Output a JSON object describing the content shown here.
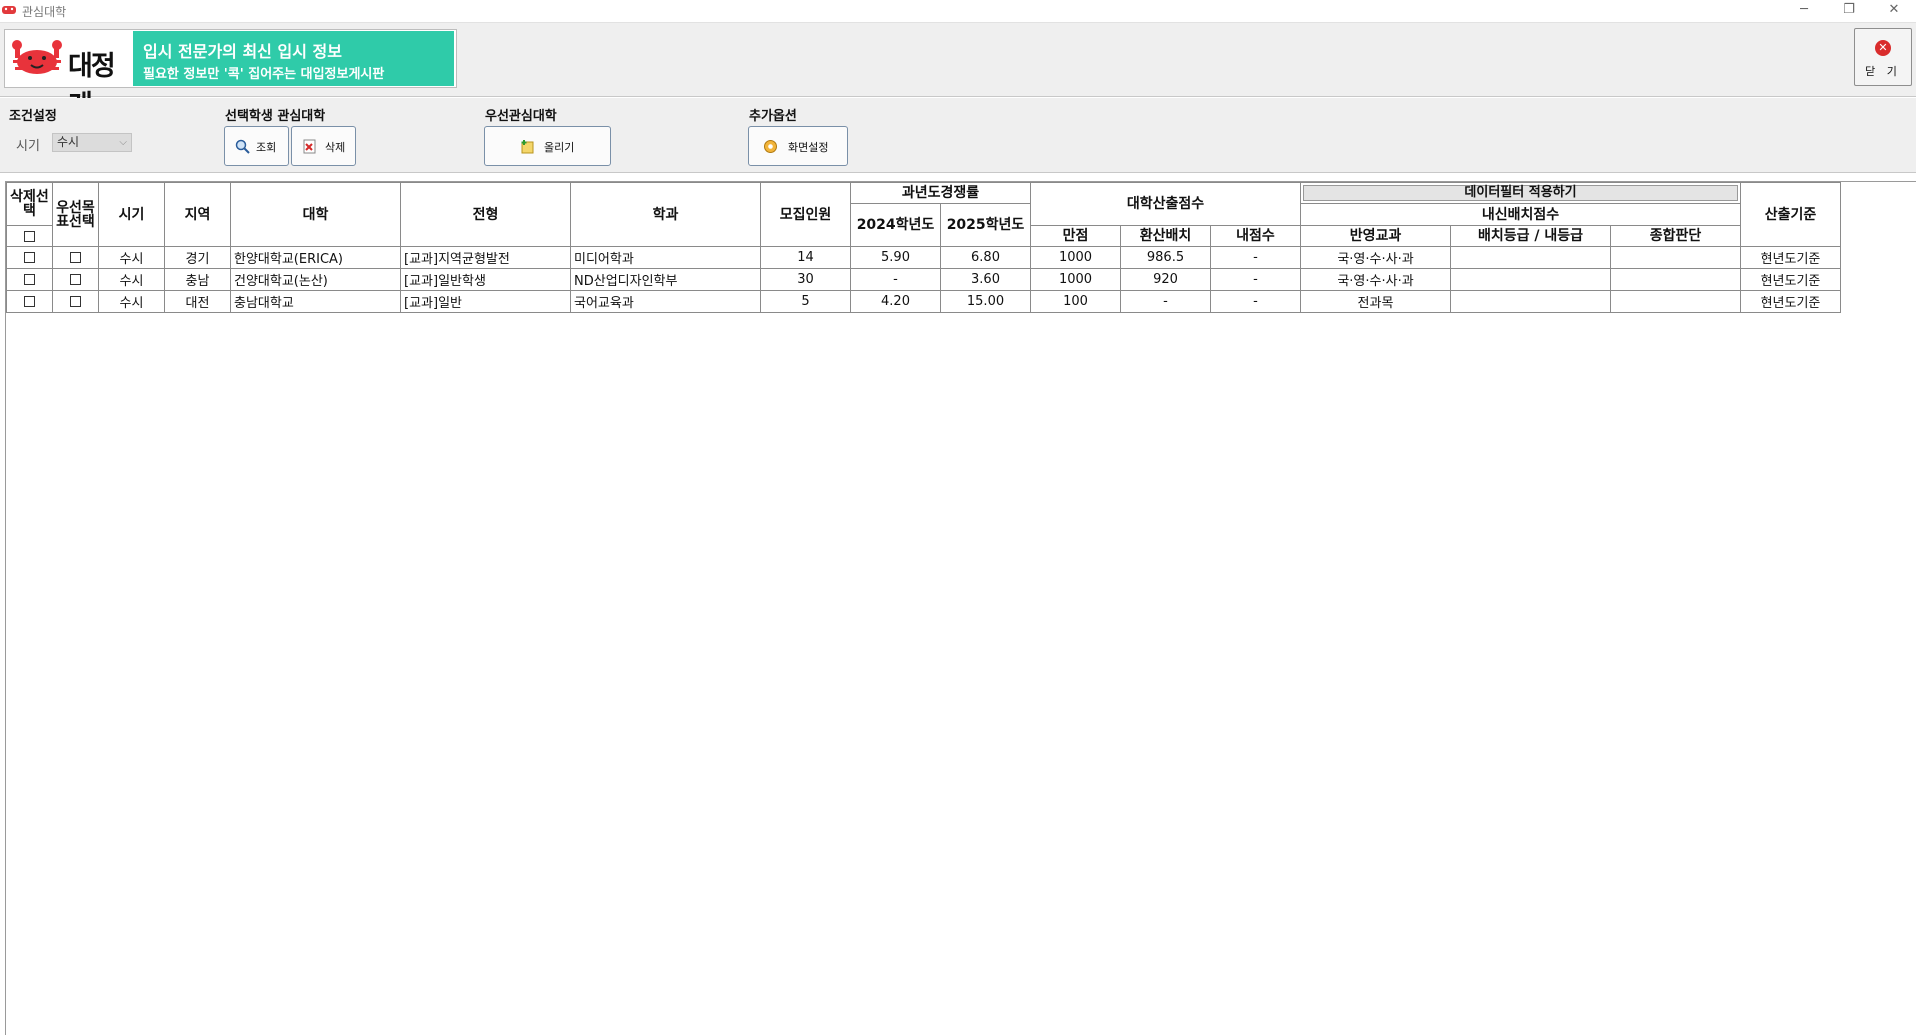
{
  "window": {
    "title": "관심대학",
    "minimize": "─",
    "restore": "❐",
    "close": "✕"
  },
  "banner": {
    "logo_text": "대정게",
    "headline": "입시 전문가의 최신 입시 정보",
    "subline": "필요한 정보만 '콕' 집어주는 대입정보게시판"
  },
  "close_button": {
    "label": "닫 기",
    "icon": "close-circle-icon"
  },
  "toolbar": {
    "condition_title": "조건설정",
    "period_label": "시기",
    "period_value": "수시",
    "selected_student_title": "선택학생 관심대학",
    "search_label": "조회",
    "delete_label": "삭제",
    "priority_title": "우선관심대학",
    "upload_label": "올리기",
    "extra_title": "추가옵션",
    "screen_setting_label": "화면설정"
  },
  "table": {
    "headers": {
      "delete_select": "삭제선택",
      "priority_select": "우선목표선택",
      "period": "시기",
      "region": "지역",
      "university": "대학",
      "admission_type": "전형",
      "department": "학과",
      "recruit": "모집인원",
      "past_competition": "과년도경쟁률",
      "year_2024": "2024학년도",
      "year_2025": "2025학년도",
      "univ_score": "대학산출점수",
      "full_score": "만점",
      "converted": "환산배치",
      "internal_score": "내점수",
      "data_filter": "데이터필터 적용하기",
      "gpa_placement": "내신배치점수",
      "reflected_subjects": "반영교과",
      "placement_grade": "배치등급 / 내등급",
      "overall": "종합판단",
      "calc_basis": "산출기준"
    },
    "rows": [
      {
        "period": "수시",
        "region": "경기",
        "university": "한양대학교(ERICA)",
        "admission_type": "[교과]지역균형발전",
        "department": "미디어학과",
        "recruit": "14",
        "rate_2024": "5.90",
        "rate_2025": "6.80",
        "full_score": "1000",
        "converted": "986.5",
        "internal_score": "-",
        "subjects": "국·영·수·사·과",
        "grade": "",
        "overall": "",
        "basis": "현년도기준"
      },
      {
        "period": "수시",
        "region": "충남",
        "university": "건양대학교(논산)",
        "admission_type": "[교과]일반학생",
        "department": "ND산업디자인학부",
        "recruit": "30",
        "rate_2024": "-",
        "rate_2025": "3.60",
        "full_score": "1000",
        "converted": "920",
        "internal_score": "-",
        "subjects": "국·영·수·사·과",
        "grade": "",
        "overall": "",
        "basis": "현년도기준"
      },
      {
        "period": "수시",
        "region": "대전",
        "university": "충남대학교",
        "admission_type": "[교과]일반",
        "department": "국어교육과",
        "recruit": "5",
        "rate_2024": "4.20",
        "rate_2025": "15.00",
        "full_score": "100",
        "converted": "-",
        "internal_score": "-",
        "subjects": "전과목",
        "grade": "",
        "overall": "",
        "basis": "현년도기준"
      }
    ]
  }
}
